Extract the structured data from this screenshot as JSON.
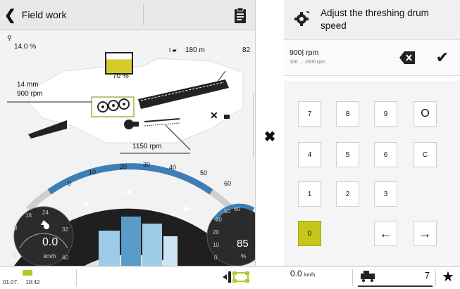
{
  "header": {
    "back_label": "Field work"
  },
  "harvest": {
    "tank_percent_icon": "grain-tank-icon",
    "field_value": "14.0 %",
    "distance_value": "180 m",
    "edge_value": "82",
    "tank_fill_label": "70 %",
    "concave_gap": "14 mm",
    "drum_speed": "900 rpm",
    "fan_speed": "1150 rpm",
    "tank_fill_fraction": 0.7
  },
  "gauge": {
    "tick_labels": [
      "0",
      "10",
      "20",
      "30",
      "40",
      "50",
      "60"
    ],
    "left_dial_ticks": [
      "8",
      "16",
      "24",
      "32",
      "40",
      "0"
    ],
    "speed_value": "0.0",
    "speed_unit": "km/h",
    "right_dial_ticks": [
      "50",
      "50",
      "60",
      "30",
      "20",
      "10",
      "0"
    ],
    "right_value": "85",
    "right_unit": "%"
  },
  "dialog": {
    "title": "Adjust the threshing drum speed",
    "input_value": "900| rpm",
    "input_range": "100 ... 1000 rpm",
    "keys": [
      "7",
      "8",
      "9",
      "O",
      "4",
      "5",
      "6",
      "C",
      "1",
      "2",
      "3",
      "0",
      "←",
      "→"
    ]
  },
  "bottom": {
    "date": "01.07.",
    "time": "10:42",
    "speed_value": "0.0",
    "speed_unit": "km/h",
    "counter_value": "7"
  },
  "colors": {
    "accent_yellow": "#c5c51b",
    "gauge_blue": "#3d7fb5",
    "gauge_dark": "#232323"
  }
}
